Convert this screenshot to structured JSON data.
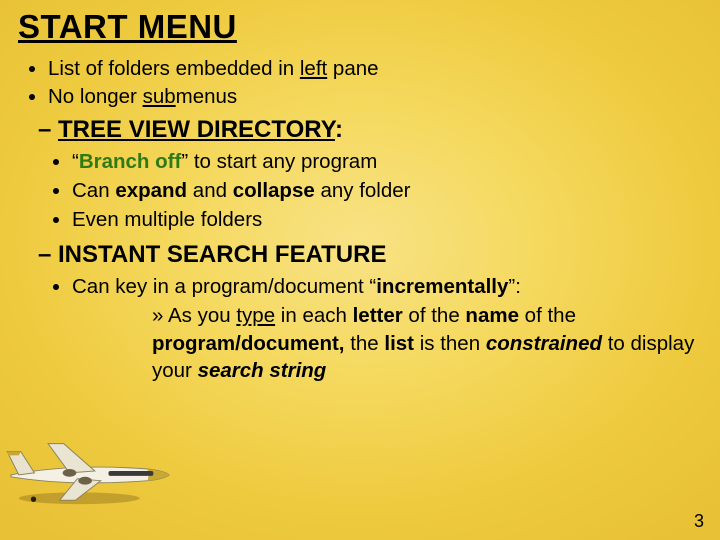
{
  "title": "START MENU",
  "bullets": {
    "b1_pre": "List of  folders embedded in ",
    "b1_u": "left",
    "b1_post": " pane",
    "b2_pre": "No longer ",
    "b2_u": "sub",
    "b2_post": "menus"
  },
  "section1": {
    "dash": "– ",
    "head": "TREE VIEW DIRECTORY",
    "colon": ":",
    "i1_pre": "“",
    "i1_green": "Branch off",
    "i1_post": "”  to start any program",
    "i2_pre": "Can ",
    "i2_b1": "expand",
    "i2_mid": " and ",
    "i2_b2": "collapse",
    "i2_post": " any folder",
    "i3": "Even multiple folders"
  },
  "section2": {
    "dash": "– ",
    "head": "INSTANT SEARCH FEATURE",
    "i1_pre": "Can key in a program/document “",
    "i1_b": "incrementally",
    "i1_post": "”:",
    "sub_marker": "» ",
    "s_t1": "As you ",
    "s_u1": "type",
    "s_t2": " in each ",
    "s_b1": "letter",
    "s_t3": " of the ",
    "s_b2": "name",
    "s_t4": " of the ",
    "s_b3": "program/document",
    "s_b4": ",",
    "s_t5": " the ",
    "s_b5": "list",
    "s_t6": " is then ",
    "s_bi1": "constrained",
    "s_t7": " to display your ",
    "s_bi2": "search string"
  },
  "pagenum": "3",
  "empty_bullet": "•"
}
